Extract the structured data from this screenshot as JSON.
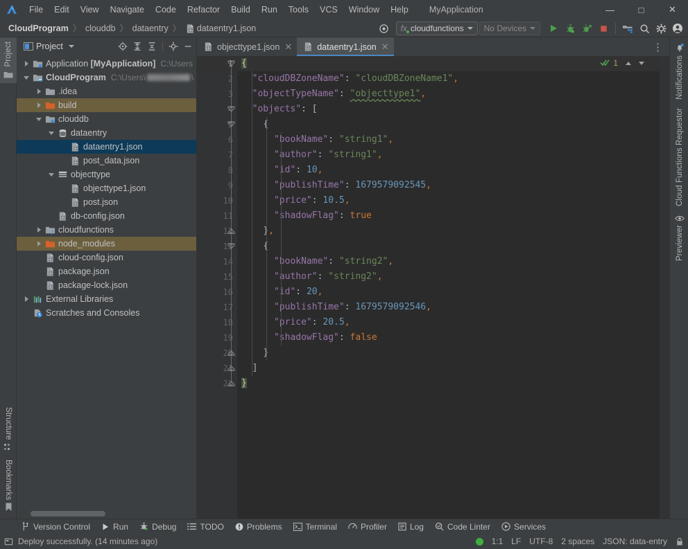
{
  "window": {
    "app_title": "MyApplication",
    "minimize_label": "—",
    "maximize_label": "□",
    "close_label": "✕"
  },
  "menubar": {
    "items": [
      {
        "label": "File"
      },
      {
        "label": "Edit"
      },
      {
        "label": "View"
      },
      {
        "label": "Navigate"
      },
      {
        "label": "Code"
      },
      {
        "label": "Refactor"
      },
      {
        "label": "Build"
      },
      {
        "label": "Run"
      },
      {
        "label": "Tools"
      },
      {
        "label": "VCS"
      },
      {
        "label": "Window"
      },
      {
        "label": "Help"
      }
    ]
  },
  "breadcrumb": {
    "items": [
      {
        "label": "CloudProgram",
        "bold": true
      },
      {
        "label": "clouddb",
        "bold": false
      },
      {
        "label": "dataentry",
        "bold": false
      },
      {
        "label": "dataentry1.json",
        "bold": false,
        "icon": "json-file-icon"
      }
    ],
    "separator": "〉"
  },
  "toolbar": {
    "target_selector": {
      "prefix": "fx",
      "label": "cloudfunctions"
    },
    "device_selector": {
      "label": "No Devices"
    },
    "buttons": [
      {
        "name": "run-button",
        "title": "Run"
      },
      {
        "name": "debug-button",
        "title": "Debug"
      },
      {
        "name": "attach-debugger-button",
        "title": "Attach Debugger"
      },
      {
        "name": "stop-button",
        "title": "Stop"
      },
      {
        "name": "device-manager-button",
        "title": "Device Manager"
      },
      {
        "name": "search-everywhere-button",
        "title": "Search Everywhere"
      },
      {
        "name": "settings-button",
        "title": "Settings"
      },
      {
        "name": "account-button",
        "title": "Account"
      }
    ]
  },
  "left_rail": {
    "top": [
      {
        "label": "Project",
        "icon": "project-folder-icon",
        "active": true
      }
    ],
    "bottom": [
      {
        "label": "Structure",
        "icon": "structure-icon"
      },
      {
        "label": "Bookmarks",
        "icon": "bookmarks-icon"
      }
    ]
  },
  "right_rail": {
    "items": [
      {
        "label": "Notifications",
        "icon": "bell-icon"
      },
      {
        "label": "Cloud Functions Requestor",
        "icon": "none"
      },
      {
        "label": "Previewer",
        "icon": "eye-icon"
      }
    ]
  },
  "project_panel": {
    "title": "Project",
    "header_icons": [
      {
        "name": "select-opened-file-icon"
      },
      {
        "name": "expand-all-icon"
      },
      {
        "name": "collapse-all-icon"
      },
      {
        "name": "gear-icon"
      },
      {
        "name": "hide-icon"
      }
    ],
    "tree": [
      {
        "label": "Application [MyApplication]",
        "path": "C:\\Users",
        "indent": 0,
        "twisty": "right",
        "icon": "module-icon",
        "bold_part": "[MyApplication]",
        "state": "none"
      },
      {
        "label": "CloudProgram",
        "path": "C:\\Users\\",
        "indent": 0,
        "twisty": "down",
        "icon": "project-module-icon",
        "bold": true,
        "state": "none",
        "blurred_path": true
      },
      {
        "label": ".idea",
        "indent": 1,
        "twisty": "right",
        "icon": "folder-icon",
        "state": "none"
      },
      {
        "label": "build",
        "indent": 1,
        "twisty": "right",
        "icon": "folder-orange-icon",
        "state": "highlight"
      },
      {
        "label": "clouddb",
        "indent": 1,
        "twisty": "down",
        "icon": "folder-db-icon",
        "state": "none"
      },
      {
        "label": "dataentry",
        "indent": 2,
        "twisty": "down",
        "icon": "database-icon",
        "state": "none"
      },
      {
        "label": "dataentry1.json",
        "indent": 3,
        "twisty": "none",
        "icon": "json-file-icon",
        "state": "selected"
      },
      {
        "label": "post_data.json",
        "indent": 3,
        "twisty": "none",
        "icon": "json-file-icon",
        "state": "none"
      },
      {
        "label": "objecttype",
        "indent": 2,
        "twisty": "down",
        "icon": "table-icon",
        "state": "none"
      },
      {
        "label": "objecttype1.json",
        "indent": 3,
        "twisty": "none",
        "icon": "json-file-icon",
        "state": "none"
      },
      {
        "label": "post.json",
        "indent": 3,
        "twisty": "none",
        "icon": "json-file-icon",
        "state": "none"
      },
      {
        "label": "db-config.json",
        "indent": 2,
        "twisty": "none",
        "icon": "json-file-icon",
        "state": "none"
      },
      {
        "label": "cloudfunctions",
        "indent": 1,
        "twisty": "right",
        "icon": "folder-fn-icon",
        "state": "none"
      },
      {
        "label": "node_modules",
        "indent": 1,
        "twisty": "right",
        "icon": "folder-orange-icon",
        "state": "highlight"
      },
      {
        "label": "cloud-config.json",
        "indent": 1,
        "twisty": "none",
        "icon": "json-file-icon",
        "state": "none"
      },
      {
        "label": "package.json",
        "indent": 1,
        "twisty": "none",
        "icon": "json-file-icon",
        "state": "none"
      },
      {
        "label": "package-lock.json",
        "indent": 1,
        "twisty": "none",
        "icon": "json-file-icon",
        "state": "none"
      },
      {
        "label": "External Libraries",
        "indent": 0,
        "twisty": "right",
        "icon": "libraries-icon",
        "state": "none"
      },
      {
        "label": "Scratches and Consoles",
        "indent": 0,
        "twisty": "none",
        "icon": "scratches-icon",
        "state": "none"
      }
    ]
  },
  "editor": {
    "tabs": [
      {
        "label": "objecttype1.json",
        "active": false,
        "icon": "json-file-icon",
        "close": "✕"
      },
      {
        "label": "dataentry1.json",
        "active": true,
        "icon": "json-file-icon",
        "close": "✕"
      }
    ],
    "overflow_label": "⋮",
    "inspection": {
      "count": "1",
      "icon": "inspection-ok-icon",
      "up": "chevron-up-icon",
      "down": "chevron-down-icon"
    },
    "line_numbers": [
      "1",
      "2",
      "3",
      "4",
      "5",
      "6",
      "7",
      "8",
      "9",
      "10",
      "11",
      "12",
      "13",
      "14",
      "15",
      "16",
      "17",
      "18",
      "19",
      "20",
      "21",
      "22"
    ],
    "cursor_line": 1,
    "lines": [
      {
        "num": 1,
        "tokens": [
          {
            "t": "{",
            "c": "brace-hl"
          }
        ]
      },
      {
        "num": 2,
        "tokens": [
          {
            "t": "  ",
            "c": "p"
          },
          {
            "t": "\"cloudDBZoneName\"",
            "c": "k"
          },
          {
            "t": ": ",
            "c": "p"
          },
          {
            "t": "\"cloudDBZoneName1\"",
            "c": "s"
          },
          {
            "t": ",",
            "c": "b"
          }
        ]
      },
      {
        "num": 3,
        "tokens": [
          {
            "t": "  ",
            "c": "p"
          },
          {
            "t": "\"objectTypeName\"",
            "c": "k"
          },
          {
            "t": ": ",
            "c": "p"
          },
          {
            "t": "\"objecttype1\"",
            "c": "s wavy"
          },
          {
            "t": ",",
            "c": "b"
          }
        ]
      },
      {
        "num": 4,
        "tokens": [
          {
            "t": "  ",
            "c": "p"
          },
          {
            "t": "\"objects\"",
            "c": "k"
          },
          {
            "t": ": ",
            "c": "p"
          },
          {
            "t": "[",
            "c": "p"
          }
        ]
      },
      {
        "num": 5,
        "tokens": [
          {
            "t": "    ",
            "c": "p"
          },
          {
            "t": "{",
            "c": "p"
          }
        ]
      },
      {
        "num": 6,
        "tokens": [
          {
            "t": "      ",
            "c": "p"
          },
          {
            "t": "\"bookName\"",
            "c": "k"
          },
          {
            "t": ": ",
            "c": "p"
          },
          {
            "t": "\"string1\"",
            "c": "s"
          },
          {
            "t": ",",
            "c": "b"
          }
        ]
      },
      {
        "num": 7,
        "tokens": [
          {
            "t": "      ",
            "c": "p"
          },
          {
            "t": "\"author\"",
            "c": "k"
          },
          {
            "t": ": ",
            "c": "p"
          },
          {
            "t": "\"string1\"",
            "c": "s"
          },
          {
            "t": ",",
            "c": "b"
          }
        ]
      },
      {
        "num": 8,
        "tokens": [
          {
            "t": "      ",
            "c": "p"
          },
          {
            "t": "\"id\"",
            "c": "k"
          },
          {
            "t": ": ",
            "c": "p"
          },
          {
            "t": "10",
            "c": "n"
          },
          {
            "t": ",",
            "c": "b"
          }
        ]
      },
      {
        "num": 9,
        "tokens": [
          {
            "t": "      ",
            "c": "p"
          },
          {
            "t": "\"publishTime\"",
            "c": "k"
          },
          {
            "t": ": ",
            "c": "p"
          },
          {
            "t": "1679579092545",
            "c": "n"
          },
          {
            "t": ",",
            "c": "b"
          }
        ]
      },
      {
        "num": 10,
        "tokens": [
          {
            "t": "      ",
            "c": "p"
          },
          {
            "t": "\"price\"",
            "c": "k"
          },
          {
            "t": ": ",
            "c": "p"
          },
          {
            "t": "10.5",
            "c": "n"
          },
          {
            "t": ",",
            "c": "b"
          }
        ]
      },
      {
        "num": 11,
        "tokens": [
          {
            "t": "      ",
            "c": "p"
          },
          {
            "t": "\"shadowFlag\"",
            "c": "k"
          },
          {
            "t": ": ",
            "c": "p"
          },
          {
            "t": "true",
            "c": "b"
          }
        ]
      },
      {
        "num": 12,
        "tokens": [
          {
            "t": "    ",
            "c": "p"
          },
          {
            "t": "}",
            "c": "p"
          },
          {
            "t": ",",
            "c": "b"
          }
        ]
      },
      {
        "num": 13,
        "tokens": [
          {
            "t": "    ",
            "c": "p"
          },
          {
            "t": "{",
            "c": "p"
          }
        ]
      },
      {
        "num": 14,
        "tokens": [
          {
            "t": "      ",
            "c": "p"
          },
          {
            "t": "\"bookName\"",
            "c": "k"
          },
          {
            "t": ": ",
            "c": "p"
          },
          {
            "t": "\"string2\"",
            "c": "s"
          },
          {
            "t": ",",
            "c": "b"
          }
        ]
      },
      {
        "num": 15,
        "tokens": [
          {
            "t": "      ",
            "c": "p"
          },
          {
            "t": "\"author\"",
            "c": "k"
          },
          {
            "t": ": ",
            "c": "p"
          },
          {
            "t": "\"string2\"",
            "c": "s"
          },
          {
            "t": ",",
            "c": "b"
          }
        ]
      },
      {
        "num": 16,
        "tokens": [
          {
            "t": "      ",
            "c": "p"
          },
          {
            "t": "\"id\"",
            "c": "k"
          },
          {
            "t": ": ",
            "c": "p"
          },
          {
            "t": "20",
            "c": "n"
          },
          {
            "t": ",",
            "c": "b"
          }
        ]
      },
      {
        "num": 17,
        "tokens": [
          {
            "t": "      ",
            "c": "p"
          },
          {
            "t": "\"publishTime\"",
            "c": "k"
          },
          {
            "t": ": ",
            "c": "p"
          },
          {
            "t": "1679579092546",
            "c": "n"
          },
          {
            "t": ",",
            "c": "b"
          }
        ]
      },
      {
        "num": 18,
        "tokens": [
          {
            "t": "      ",
            "c": "p"
          },
          {
            "t": "\"price\"",
            "c": "k"
          },
          {
            "t": ": ",
            "c": "p"
          },
          {
            "t": "20.5",
            "c": "n"
          },
          {
            "t": ",",
            "c": "b"
          }
        ]
      },
      {
        "num": 19,
        "tokens": [
          {
            "t": "      ",
            "c": "p"
          },
          {
            "t": "\"shadowFlag\"",
            "c": "k"
          },
          {
            "t": ": ",
            "c": "p"
          },
          {
            "t": "false",
            "c": "b"
          }
        ]
      },
      {
        "num": 20,
        "tokens": [
          {
            "t": "    ",
            "c": "p"
          },
          {
            "t": "}",
            "c": "p"
          }
        ]
      },
      {
        "num": 21,
        "tokens": [
          {
            "t": "  ",
            "c": "p"
          },
          {
            "t": "]",
            "c": "p"
          }
        ]
      },
      {
        "num": 22,
        "tokens": [
          {
            "t": "}",
            "c": "brace-hl"
          }
        ]
      }
    ]
  },
  "tool_window_bar": {
    "items": [
      {
        "label": "Version Control",
        "icon": "branch-icon"
      },
      {
        "label": "Run",
        "icon": "run-icon"
      },
      {
        "label": "Debug",
        "icon": "debug-icon"
      },
      {
        "label": "TODO",
        "icon": "todo-icon"
      },
      {
        "label": "Problems",
        "icon": "problems-icon"
      },
      {
        "label": "Terminal",
        "icon": "terminal-icon"
      },
      {
        "label": "Profiler",
        "icon": "profiler-icon"
      },
      {
        "label": "Log",
        "icon": "log-icon"
      },
      {
        "label": "Code Linter",
        "icon": "code-linter-icon"
      },
      {
        "label": "Services",
        "icon": "services-icon"
      }
    ]
  },
  "statusbar": {
    "message": "Deploy successfully. (14 minutes ago)",
    "message_icon": "event-log-icon",
    "caret_position": "1:1",
    "line_separator": "LF",
    "encoding": "UTF-8",
    "indent": "2 spaces",
    "file_type": "JSON: data-entry",
    "lock_icon": "lock-icon",
    "status_dot_color": "#3fae3f"
  },
  "colors": {
    "accent": "#4a88c7",
    "selection": "#0d3a58",
    "highlight_row": "#6b5f3e",
    "editor_bg": "#2b2b2b",
    "chrome_bg": "#3c3f41"
  }
}
